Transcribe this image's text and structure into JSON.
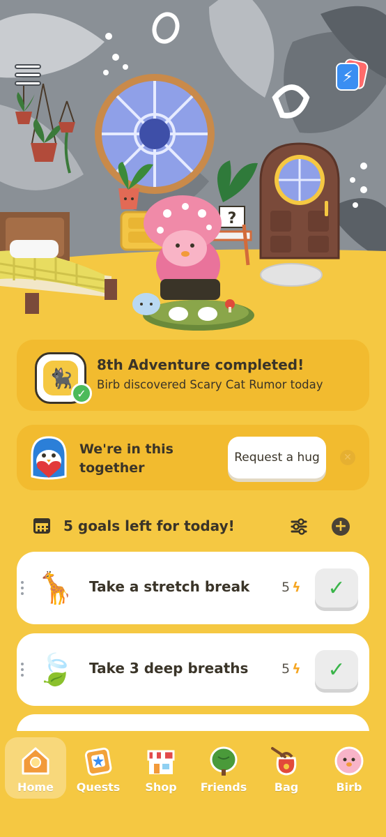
{
  "scene": {
    "menu_icon": "hamburger-icon",
    "energy_icon": "lightning-cards-icon",
    "energy_symbol": "⚡",
    "mystery_sign": "?"
  },
  "adventure": {
    "title": "8th Adventure completed!",
    "subtitle": "Birb discovered Scary Cat Rumor today",
    "icon": "black-cat-icon",
    "icon_glyph": "🐈‍⬛",
    "check": "✓"
  },
  "hug": {
    "text": "We're in this together",
    "button_label": "Request a hug",
    "close_glyph": "✕"
  },
  "goals": {
    "title": "5 goals left for today!",
    "add_glyph": "+",
    "items": [
      {
        "label": "Take a stretch break",
        "points": "5",
        "emoji": "🦒",
        "icon": "giraffe-icon",
        "check": "✓"
      },
      {
        "label": "Take 3 deep breaths",
        "points": "5",
        "emoji": "🍃",
        "icon": "leaf-icon",
        "check": "✓"
      }
    ],
    "bolt": "ϟ"
  },
  "nav": {
    "items": [
      {
        "label": "Home",
        "icon": "house-icon",
        "active": true
      },
      {
        "label": "Quests",
        "icon": "quest-board-icon",
        "active": false
      },
      {
        "label": "Shop",
        "icon": "shop-icon",
        "active": false
      },
      {
        "label": "Friends",
        "icon": "tree-icon",
        "active": false
      },
      {
        "label": "Bag",
        "icon": "bag-icon",
        "active": false
      },
      {
        "label": "Birb",
        "icon": "birb-icon",
        "active": false
      }
    ]
  },
  "colors": {
    "background": "#f5c842",
    "card": "#f2bb2f",
    "check_green": "#3ab54a",
    "bolt": "#f5a623",
    "text": "#3a3428"
  }
}
